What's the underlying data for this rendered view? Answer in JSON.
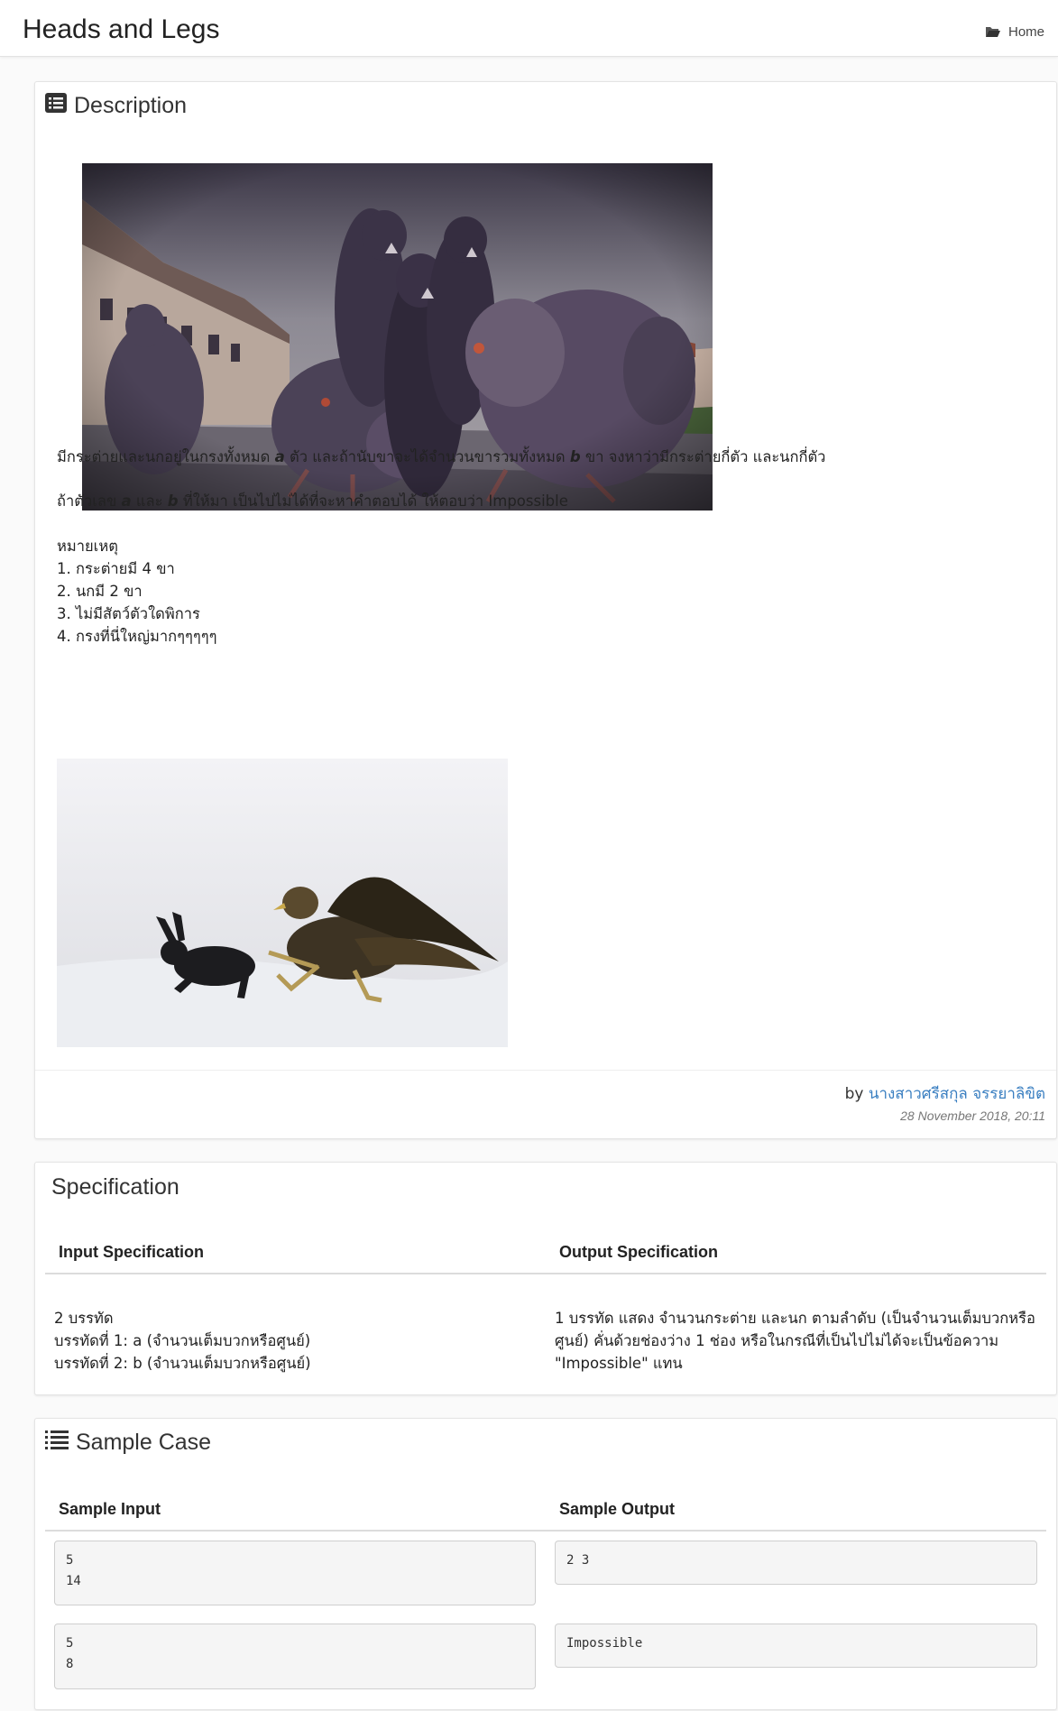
{
  "header": {
    "title": "Heads and Legs",
    "breadcrumb_home": "Home"
  },
  "description": {
    "heading": "Description",
    "paragraph1_pre": "มีกระต่ายและนกอยู่ในกรงทั้งหมด ",
    "var_a": "a",
    "paragraph1_mid": " ตัว และถ้านับขาจะได้จำนวนขารวมทั้งหมด ",
    "var_b": "b",
    "paragraph1_post": " ขา จงหาว่ามีกระต่ายกี่ตัว และนกกี่ตัว",
    "paragraph2_pre": "ถ้าตัวเลข ",
    "paragraph2_and": " และ ",
    "paragraph2_post": " ที่ให้มา เป็นไปไม่ได้ที่จะหาคำตอบได้ ให้ตอบว่า Impossible",
    "note_title": "หมายเหตุ",
    "notes": [
      "1. กระต่ายมี 4 ขา",
      "2. นกมี 2 ขา",
      "3. ไม่มีสัตว์ตัวใดพิการ",
      "4. กรงที่นี่ใหญ่มากๆๆๆๆๆ"
    ],
    "by_label": "by",
    "author": "นางสาวศรีสกุล จรรยาลิขิต",
    "date": "28 November 2018, 20:11"
  },
  "specification": {
    "heading": "Specification",
    "input_header": "Input Specification",
    "output_header": "Output Specification",
    "input_lines": [
      "2 บรรทัด",
      "บรรทัดที่ 1: a (จำนวนเต็มบวกหรือศูนย์)",
      "บรรทัดที่ 2: b (จำนวนเต็มบวกหรือศูนย์)"
    ],
    "output_lines": [
      "1 บรรทัด แสดง จำนวนกระต่าย และนก ตามลำดับ (เป็นจำนวนเต็มบวกหรือ",
      "ศูนย์) คั่นด้วยช่องว่าง 1 ช่อง หรือในกรณีที่เป็นไปไม่ได้จะเป็นข้อความ",
      "\"Impossible\" แทน"
    ]
  },
  "samples": {
    "heading": "Sample Case",
    "input_header": "Sample Input",
    "output_header": "Sample Output",
    "cases": [
      {
        "input": "5\n14",
        "output": "2 3"
      },
      {
        "input": "5\n8",
        "output": "Impossible"
      }
    ]
  },
  "colors": {
    "link": "#3a7fc1",
    "code_bg": "#f5f5f5"
  },
  "icons": [
    "folder-open-icon",
    "list-alt-icon",
    "list-ol-icon"
  ]
}
